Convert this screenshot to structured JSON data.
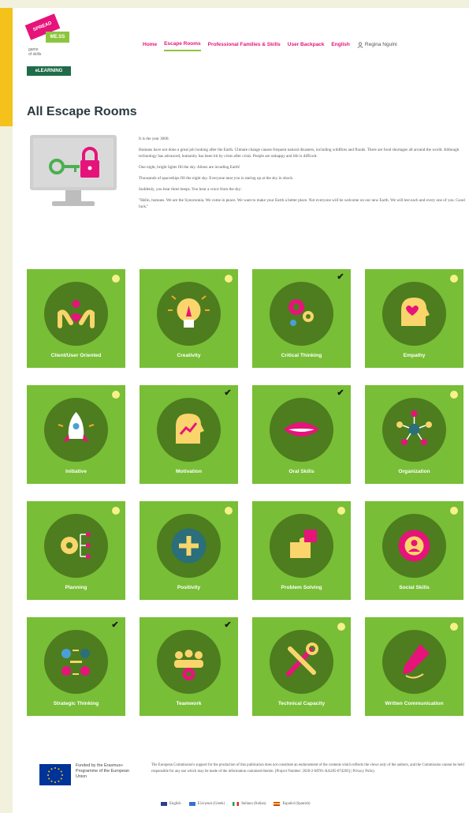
{
  "logo": {
    "line1": "SPREAD",
    "line2": "ME.SS",
    "small_lines": [
      "game",
      "of skills"
    ],
    "bar": "eLEARNING"
  },
  "nav": {
    "items": [
      {
        "label": "Home",
        "active": false
      },
      {
        "label": "Escape Rooms",
        "active": true
      },
      {
        "label": "Professional Families & Skills",
        "active": false
      },
      {
        "label": "User Backpack",
        "active": false
      },
      {
        "label": "English",
        "active": false
      }
    ],
    "user": "Regina Ngulni",
    "user_icon": "user-icon"
  },
  "page_title": "All Escape Rooms",
  "intro": {
    "paragraphs": [
      "It is the year 3000.",
      "Humans have not done a great job looking after the Earth. Climate change causes frequent natural disasters, including wildfires and floods. There are food shortages all around the world. Although technology has advanced, humanity has been hit by crisis after crisis. People are unhappy and life is difficult.",
      "One night, bright lights fill the sky. Aliens are invading Earth!",
      "Thousands of spaceships fill the night sky. Everyone near you is staring up at the sky in shock.",
      "Suddenly, you hear three beeps. You hear a voice from the sky:",
      "\"Hello, humans. We are the Synoronnia. We come in peace. We want to make your Earth a better place. Not everyone will be welcome on our new Earth. We will test each and every one of you. Good luck.\""
    ]
  },
  "rooms": [
    {
      "label": "Client/User Oriented",
      "status": "dot",
      "icon": "hands-heart-icon"
    },
    {
      "label": "Creativity",
      "status": "dot",
      "icon": "lightbulb-icon"
    },
    {
      "label": "Critical Thinking",
      "status": "check",
      "icon": "gears-head-icon"
    },
    {
      "label": "Empathy",
      "status": "dot",
      "icon": "head-heart-icon"
    },
    {
      "label": "Initiative",
      "status": "dot",
      "icon": "rocket-icon"
    },
    {
      "label": "Motivation",
      "status": "check",
      "icon": "head-chart-icon"
    },
    {
      "label": "Oral Skills",
      "status": "check",
      "icon": "lips-icon"
    },
    {
      "label": "Organization",
      "status": "dot",
      "icon": "network-icon"
    },
    {
      "label": "Planning",
      "status": "dot",
      "icon": "gear-plan-icon"
    },
    {
      "label": "Positivity",
      "status": "dot",
      "icon": "plus-icon"
    },
    {
      "label": "Problem Solving",
      "status": "dot",
      "icon": "puzzle-icon"
    },
    {
      "label": "Social Skills",
      "status": "dot",
      "icon": "social-gear-icon"
    },
    {
      "label": "Strategic Thinking",
      "status": "check",
      "icon": "strategy-icon"
    },
    {
      "label": "Teamwork",
      "status": "check",
      "icon": "team-icon"
    },
    {
      "label": "Technical Capacity",
      "status": "dot",
      "icon": "tools-icon"
    },
    {
      "label": "Written Communication",
      "status": "dot",
      "icon": "pen-icon"
    }
  ],
  "check_glyph": "✔",
  "footer": {
    "funded": "Funded by the Erasmus+ Programme of the European Union",
    "disclaimer": "The European Commission's support for the production of this publication does not constitute an endorsement of the contents which reflects the views only of the authors, and the Commission cannot be held responsible for any use which may be made of the information contained therein. [Project Number: 2020-2-MT01-KA205-074283] | Privacy Policy",
    "languages": [
      "English",
      "Ελληνικά (Greek)",
      "Italiano (Italian)",
      "Español (Spanish)"
    ]
  },
  "colors": {
    "accent": "#e6137a",
    "card_green": "#78be36",
    "circle_green": "#4d7d1f",
    "nav_underline": "#8cc63f"
  }
}
